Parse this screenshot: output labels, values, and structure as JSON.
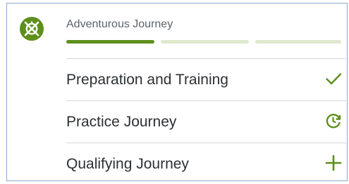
{
  "section": {
    "title": "Adventurous Journey",
    "badge_icon": "compass-icon",
    "progress": {
      "segments": [
        {
          "state": "complete",
          "color": "#5e8f1c"
        },
        {
          "state": "pending",
          "color": "#dde8cd"
        },
        {
          "state": "pending",
          "color": "#dde8cd"
        }
      ]
    }
  },
  "items": [
    {
      "label": "Preparation and Training",
      "status_icon": "checkmark-icon",
      "status": "completed"
    },
    {
      "label": "Practice Journey",
      "status_icon": "clock-refresh-icon",
      "status": "in-progress"
    },
    {
      "label": "Qualifying Journey",
      "status_icon": "plus-icon",
      "status": "not-started"
    }
  ],
  "colors": {
    "accent": "#5e8f1c",
    "progress_empty": "#dde8cd",
    "border": "#8aa6cf",
    "divider": "#d4d7da",
    "text": "#2d3033",
    "muted_text": "#5d6268"
  }
}
